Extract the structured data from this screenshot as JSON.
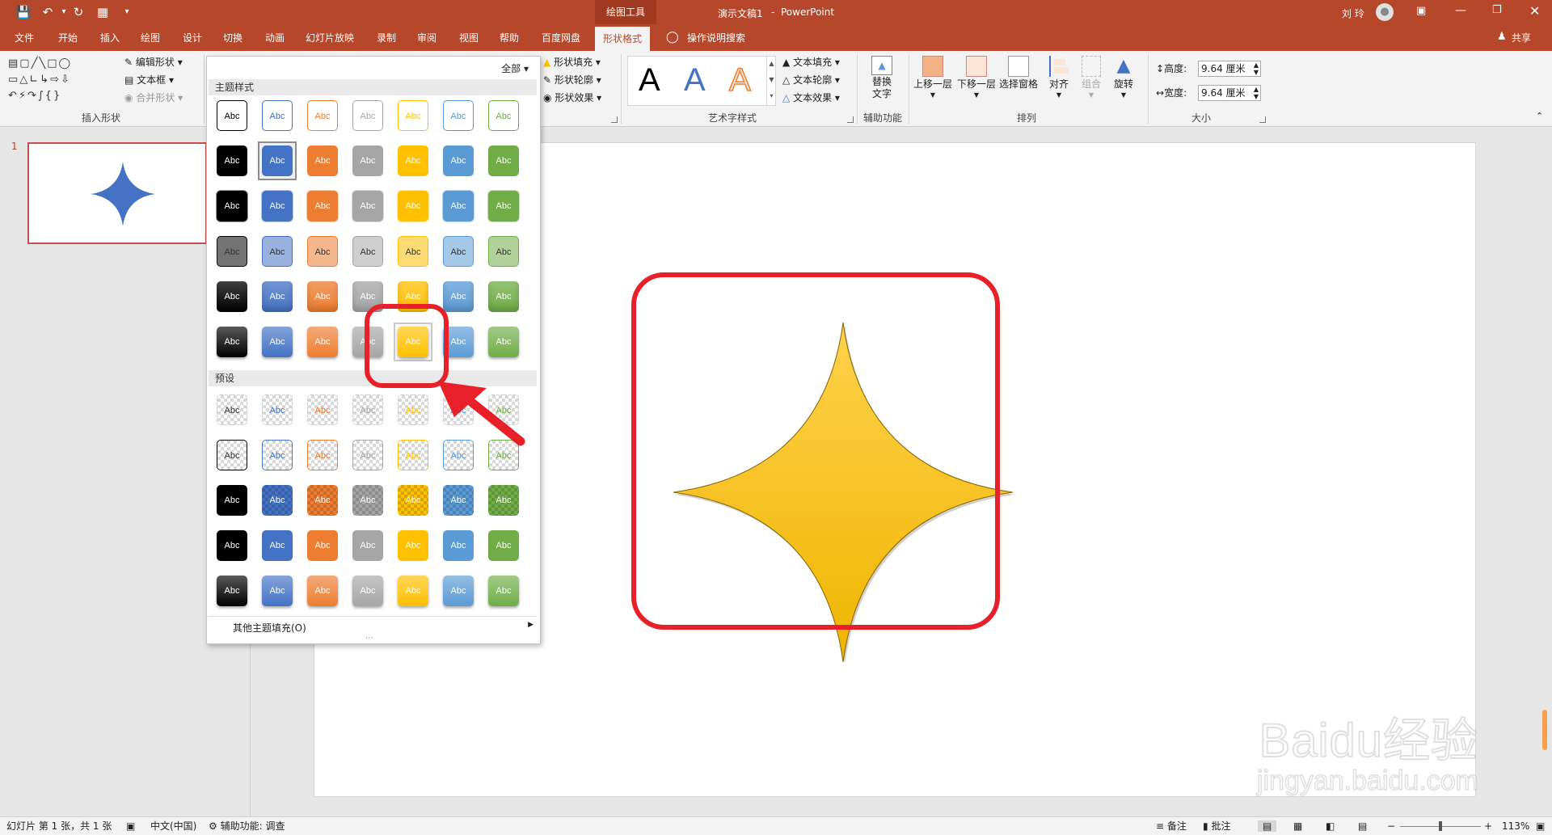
{
  "window": {
    "context_tool": "绘图工具",
    "doc_title": "演示文稿1",
    "app_name": "PowerPoint",
    "user": "刘 玲",
    "share": "共享"
  },
  "tabs": [
    {
      "label": "文件"
    },
    {
      "label": "开始"
    },
    {
      "label": "插入"
    },
    {
      "label": "绘图"
    },
    {
      "label": "设计"
    },
    {
      "label": "切换"
    },
    {
      "label": "动画"
    },
    {
      "label": "幻灯片放映"
    },
    {
      "label": "录制"
    },
    {
      "label": "审阅"
    },
    {
      "label": "视图"
    },
    {
      "label": "帮助"
    },
    {
      "label": "百度网盘"
    },
    {
      "label": "形状格式"
    }
  ],
  "tell_me": "操作说明搜索",
  "ribbon": {
    "insert_shapes": {
      "edit_shape": "编辑形状",
      "textbox": "文本框",
      "merge_shapes": "合并形状",
      "label": "插入形状"
    },
    "shape_styles": {
      "fill": "形状填充",
      "outline": "形状轮廓",
      "effects": "形状效果"
    },
    "wordart": {
      "letter": "A",
      "text_fill": "文本填充",
      "text_outline": "文本轮廓",
      "text_effects": "文本效果",
      "label": "艺术字样式"
    },
    "accessibility": {
      "alt_text_1": "替换",
      "alt_text_2": "文字",
      "label": "辅助功能"
    },
    "arrange": {
      "bring_forward": "上移一层",
      "send_backward": "下移一层",
      "selection_pane": "选择窗格",
      "align": "对齐",
      "group": "组合",
      "rotate": "旋转",
      "label": "排列"
    },
    "size": {
      "height_label": "高度:",
      "height_value": "9.64 厘米",
      "width_label": "宽度:",
      "width_value": "9.64 厘米",
      "label": "大小"
    }
  },
  "gallery": {
    "filter": "全部",
    "theme_styles_header": "主题样式",
    "presets_header": "预设",
    "swatch_text": "Abc",
    "more_fills": "其他主题填充(O)",
    "theme_colors": [
      "#000000",
      "#4472c4",
      "#ed7d31",
      "#a5a5a5",
      "#ffc000",
      "#5b9bd5",
      "#70ad47"
    ]
  },
  "slide_panel": {
    "number": "1"
  },
  "status": {
    "slide_info": "幻灯片 第 1 张，共 1 张",
    "language": "中文(中国)",
    "accessibility": "辅助功能: 调查",
    "notes": "备注",
    "comments": "批注",
    "zoom": "113%"
  },
  "watermark": {
    "line1": "Baidu经验",
    "line2": "jingyan.baidu.com"
  },
  "colors": {
    "accent": "#b7472a",
    "highlight_red": "#e8202a",
    "star_fill": "#ffc000",
    "thumb_star": "#4472c4"
  }
}
